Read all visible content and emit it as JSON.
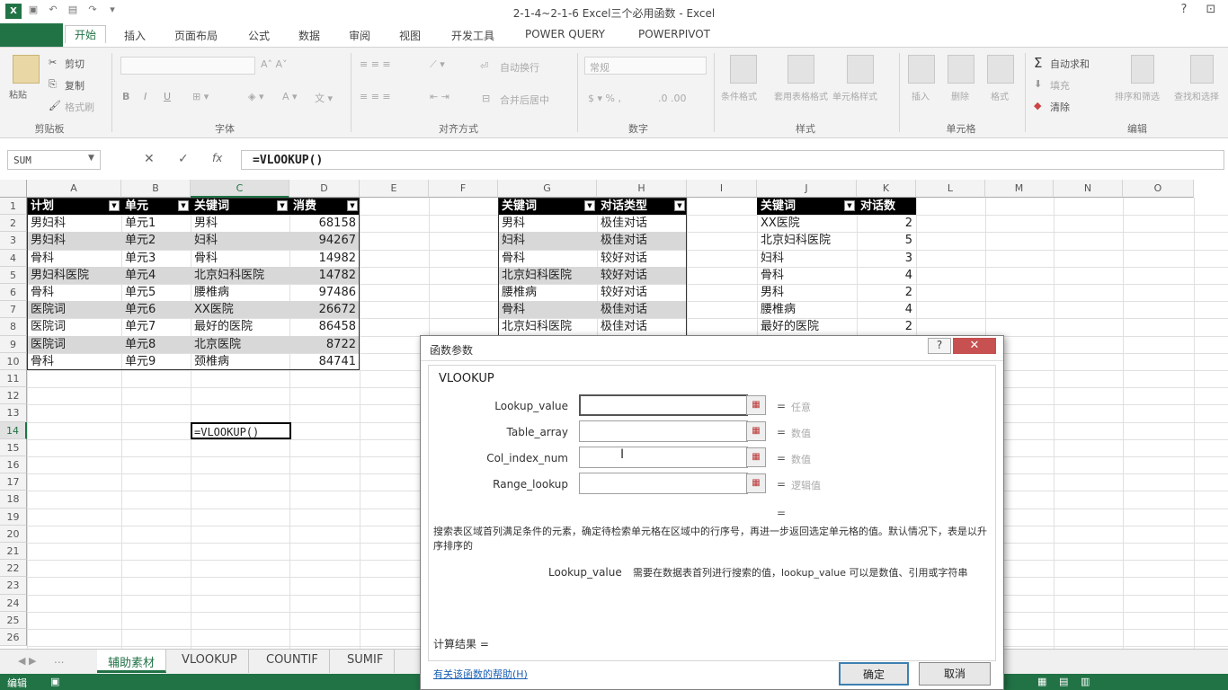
{
  "window": {
    "title": "2-1-4~2-1-6 Excel三个必用函数 - Excel",
    "help": "?",
    "logo": "X"
  },
  "ribbon_tabs": [
    "开始",
    "插入",
    "页面布局",
    "公式",
    "数据",
    "审阅",
    "视图",
    "开发工具",
    "POWER QUERY",
    "POWERPIVOT"
  ],
  "ribbon": {
    "paste": "粘贴",
    "cut": "剪切",
    "copy": "复制",
    "format_painter": "格式刷",
    "bold": "B",
    "italic": "I",
    "underline": "U",
    "wrap_text": "自动换行",
    "merge_center": "合并后居中",
    "number_format": "常规",
    "cond_format": "条件格式",
    "table_format": "套用表格格式",
    "cell_style": "单元格样式",
    "insert": "插入",
    "delete": "删除",
    "format": "格式",
    "autosum": "自动求和",
    "fill": "填充",
    "clear": "清除",
    "sort_filter": "排序和筛选",
    "find_select": "查找和选择",
    "groups": [
      "剪贴板",
      "字体",
      "对齐方式",
      "数字",
      "样式",
      "单元格",
      "编辑"
    ]
  },
  "formula_bar": {
    "name_box": "SUM",
    "cancel": "✕",
    "enter": "✓",
    "fx": "fx",
    "formula": "=VLOOKUP()"
  },
  "columns": [
    "A",
    "B",
    "C",
    "D",
    "E",
    "F",
    "G",
    "H",
    "I",
    "J",
    "K",
    "L",
    "M",
    "N",
    "O"
  ],
  "rows": [
    "1",
    "2",
    "3",
    "4",
    "5",
    "6",
    "7",
    "8",
    "9",
    "10",
    "11",
    "12",
    "13",
    "14",
    "15",
    "16",
    "17",
    "18",
    "19",
    "20",
    "21",
    "22",
    "23",
    "24",
    "25",
    "26"
  ],
  "table1": {
    "headers": [
      "计划",
      "单元",
      "关键词",
      "消费"
    ],
    "rows": [
      [
        "男妇科",
        "单元1",
        "男科",
        "68158"
      ],
      [
        "男妇科",
        "单元2",
        "妇科",
        "94267"
      ],
      [
        "骨科",
        "单元3",
        "骨科",
        "14982"
      ],
      [
        "男妇科医院",
        "单元4",
        "北京妇科医院",
        "14782"
      ],
      [
        "骨科",
        "单元5",
        "腰椎病",
        "97486"
      ],
      [
        "医院词",
        "单元6",
        "XX医院",
        "26672"
      ],
      [
        "医院词",
        "单元7",
        "最好的医院",
        "86458"
      ],
      [
        "医院词",
        "单元8",
        "北京医院",
        "8722"
      ],
      [
        "骨科",
        "单元9",
        "颈椎病",
        "84741"
      ]
    ]
  },
  "table2": {
    "headers": [
      "关键词",
      "对话类型"
    ],
    "rows": [
      [
        "男科",
        "极佳对话"
      ],
      [
        "妇科",
        "极佳对话"
      ],
      [
        "骨科",
        "较好对话"
      ],
      [
        "北京妇科医院",
        "较好对话"
      ],
      [
        "腰椎病",
        "较好对话"
      ],
      [
        "骨科",
        "极佳对话"
      ],
      [
        "北京妇科医院",
        "极佳对话"
      ]
    ]
  },
  "table3": {
    "headers": [
      "关键词",
      "对话数"
    ],
    "rows": [
      [
        "XX医院",
        "2"
      ],
      [
        "北京妇科医院",
        "5"
      ],
      [
        "妇科",
        "3"
      ],
      [
        "骨科",
        "4"
      ],
      [
        "男科",
        "2"
      ],
      [
        "腰椎病",
        "4"
      ],
      [
        "最好的医院",
        "2"
      ]
    ]
  },
  "active_cell": {
    "ref": "C14",
    "value": "=VLOOKUP()"
  },
  "sheet_tabs": [
    "...",
    "辅助素材",
    "VLOOKUP",
    "COUNTIF",
    "SUMIF"
  ],
  "status": {
    "mode": "编辑"
  },
  "dialog": {
    "title": "函数参数",
    "function_name": "VLOOKUP",
    "args": [
      {
        "label": "Lookup_value",
        "hint": "任意"
      },
      {
        "label": "Table_array",
        "hint": "数值"
      },
      {
        "label": "Col_index_num",
        "hint": "数值"
      },
      {
        "label": "Range_lookup",
        "hint": "逻辑值"
      }
    ],
    "result_eq": "=",
    "description": "搜索表区域首列满足条件的元素，确定待检索单元格在区域中的行序号，再进一步返回选定单元格的值。默认情况下，表是以升序排序的",
    "arg_desc_name": "Lookup_value",
    "arg_desc_text": "需要在数据表首列进行搜索的值，lookup_value 可以是数值、引用或字符串",
    "result_label": "计算结果 =",
    "help_link": "有关该函数的帮助(H)",
    "ok": "确定",
    "cancel": "取消"
  }
}
